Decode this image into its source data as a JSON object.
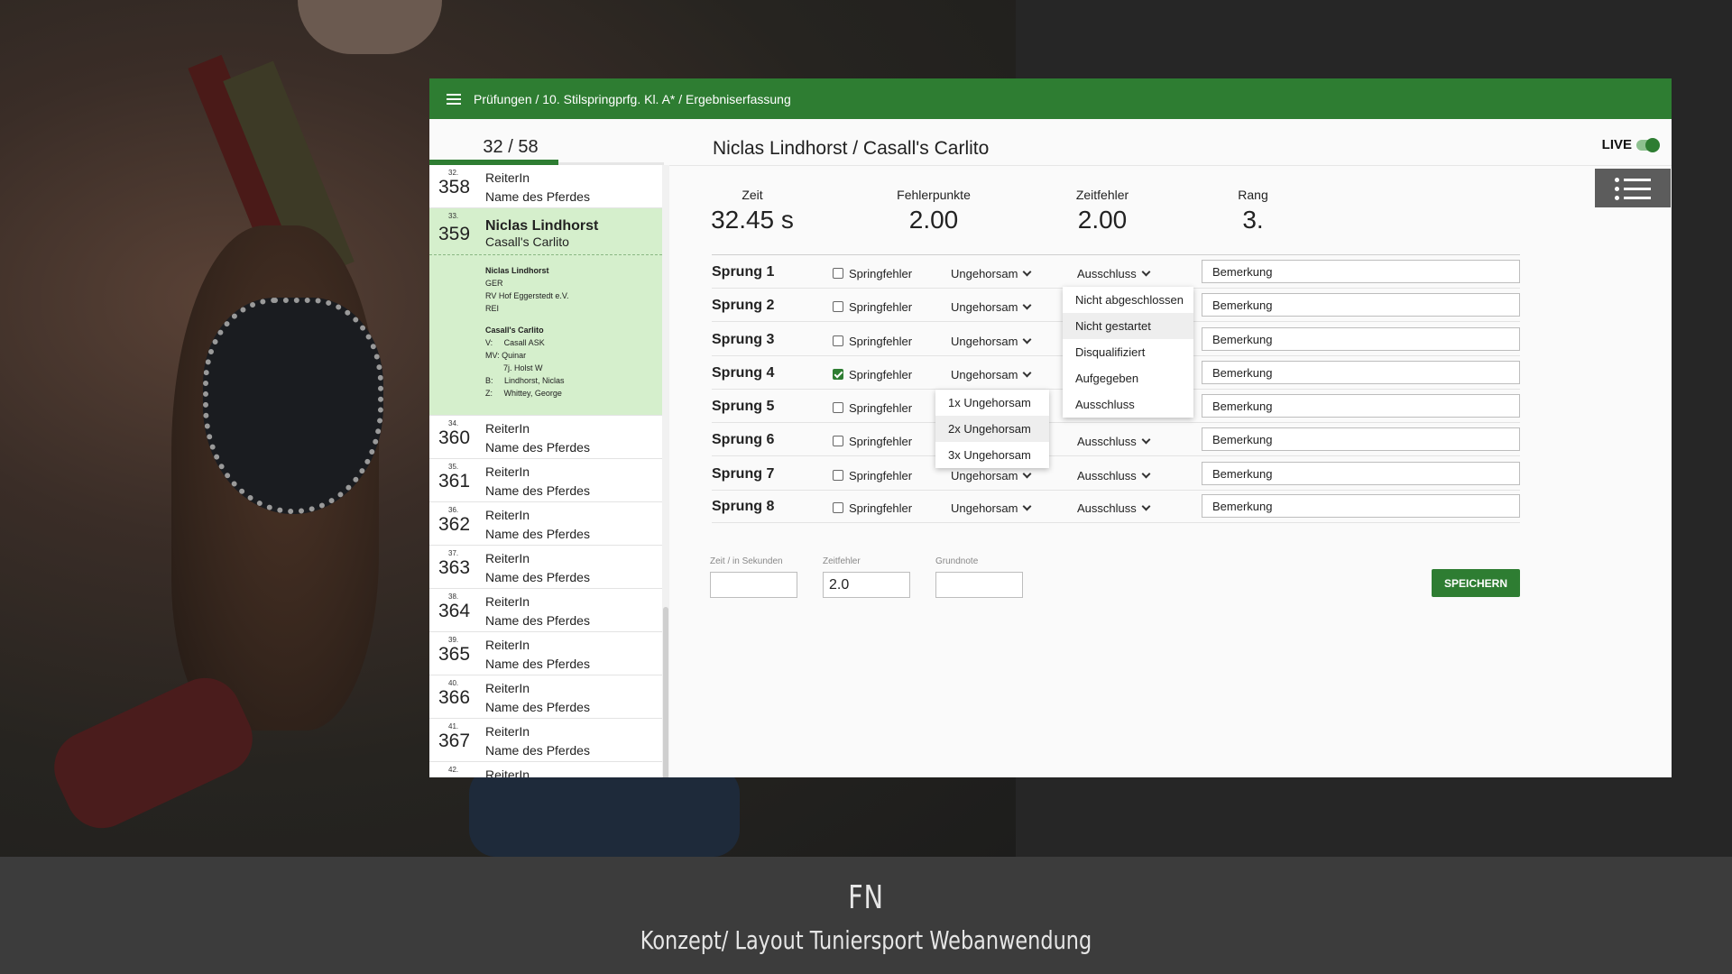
{
  "breadcrumb": "Prüfungen / 10. Stilspringprfg. Kl. A* / Ergebniserfassung",
  "counter": {
    "text": "32 / 58",
    "progress": 0.55
  },
  "rider_title": "Niclas Lindhorst / Casall's Carlito",
  "live_label": "LIVE",
  "live_on": true,
  "sidebar": {
    "rows_before": [
      {
        "idx": "32.",
        "num": "358",
        "name": "ReiterIn",
        "horse": "Name des Pferdes"
      }
    ],
    "selected": {
      "idx": "33.",
      "num": "359",
      "name": "Niclas Lindhorst",
      "horse": "Casall's Carlito"
    },
    "details": {
      "rider_name": "Niclas Lindhorst",
      "nation": "GER",
      "club": "RV Hof Eggerstedt e.V.",
      "region": "REI",
      "horse_name": "Casall's Carlito",
      "v": "V:     Casall ASK",
      "mv": "MV: Quinar",
      "breed": "7j. Holst W",
      "b": "B:     Lindhorst, Niclas",
      "z": "Z:     Whittey, George"
    },
    "rows_after": [
      {
        "idx": "34.",
        "num": "360",
        "name": "ReiterIn",
        "horse": "Name des Pferdes"
      },
      {
        "idx": "35.",
        "num": "361",
        "name": "ReiterIn",
        "horse": "Name des Pferdes"
      },
      {
        "idx": "36.",
        "num": "362",
        "name": "ReiterIn",
        "horse": "Name des Pferdes"
      },
      {
        "idx": "37.",
        "num": "363",
        "name": "ReiterIn",
        "horse": "Name des Pferdes"
      },
      {
        "idx": "38.",
        "num": "364",
        "name": "ReiterIn",
        "horse": "Name des Pferdes"
      },
      {
        "idx": "39.",
        "num": "365",
        "name": "ReiterIn",
        "horse": "Name des Pferdes"
      },
      {
        "idx": "40.",
        "num": "366",
        "name": "ReiterIn",
        "horse": "Name des Pferdes"
      },
      {
        "idx": "41.",
        "num": "367",
        "name": "ReiterIn",
        "horse": "Name des Pferdes"
      },
      {
        "idx": "42.",
        "num": "",
        "name": "ReiterIn",
        "horse": ""
      }
    ]
  },
  "stats": [
    {
      "label": "Zeit",
      "value": "32.45 s"
    },
    {
      "label": "Fehlerpunkte",
      "value": "2.00"
    },
    {
      "label": "Zeitfehler",
      "value": "2.00"
    },
    {
      "label": "Rang",
      "value": "3."
    }
  ],
  "jumps": [
    {
      "label": "Sprung 1",
      "checkbox_label": "Springfehler",
      "checked": false,
      "disobedience": "Ungehorsam",
      "exclusion": "Ausschluss",
      "remark": "Bemerkung"
    },
    {
      "label": "Sprung 2",
      "checkbox_label": "Springfehler",
      "checked": false,
      "disobedience": "Ungehorsam",
      "exclusion": "",
      "remark": "Bemerkung"
    },
    {
      "label": "Sprung 3",
      "checkbox_label": "Springfehler",
      "checked": false,
      "disobedience": "Ungehorsam",
      "exclusion": "",
      "remark": "Bemerkung"
    },
    {
      "label": "Sprung 4",
      "checkbox_label": "Springfehler",
      "checked": true,
      "disobedience": "Ungehorsam",
      "exclusion": "",
      "remark": "Bemerkung"
    },
    {
      "label": "Sprung 5",
      "checkbox_label": "Springfehler",
      "checked": false,
      "disobedience": "",
      "exclusion": "",
      "remark": "Bemerkung"
    },
    {
      "label": "Sprung 6",
      "checkbox_label": "Springfehler",
      "checked": false,
      "disobedience": "",
      "exclusion": "Ausschluss",
      "remark": "Bemerkung"
    },
    {
      "label": "Sprung 7",
      "checkbox_label": "Springfehler",
      "checked": false,
      "disobedience": "Ungehorsam",
      "exclusion": "Ausschluss",
      "remark": "Bemerkung"
    },
    {
      "label": "Sprung 8",
      "checkbox_label": "Springfehler",
      "checked": false,
      "disobedience": "Ungehorsam",
      "exclusion": "Ausschluss",
      "remark": "Bemerkung"
    }
  ],
  "exclusion_menu": {
    "options": [
      "Nicht abgeschlossen",
      "Nicht gestartet",
      "Disqualifiziert",
      "Aufgegeben",
      "Ausschluss"
    ],
    "highlighted": "Nicht gestartet"
  },
  "disobedience_menu": {
    "options": [
      "1x Ungehorsam",
      "2x Ungehorsam",
      "3x Ungehorsam"
    ],
    "highlighted": "2x Ungehorsam"
  },
  "form": {
    "time_label": "Zeit / in Sekunden",
    "time_value": "",
    "time_fault_label": "Zeitfehler",
    "time_fault_value": "2.0",
    "base_grade_label": "Grundnote",
    "base_grade_value": "",
    "save_label": "SPEICHERN"
  },
  "footer": {
    "title": "FN",
    "subtitle": "Konzept/ Layout Tuniersport Webanwendung"
  },
  "colors": {
    "primary": "#2e7d32",
    "selected_row": "#d5efcc",
    "footer_bg": "#3c3c3c"
  }
}
